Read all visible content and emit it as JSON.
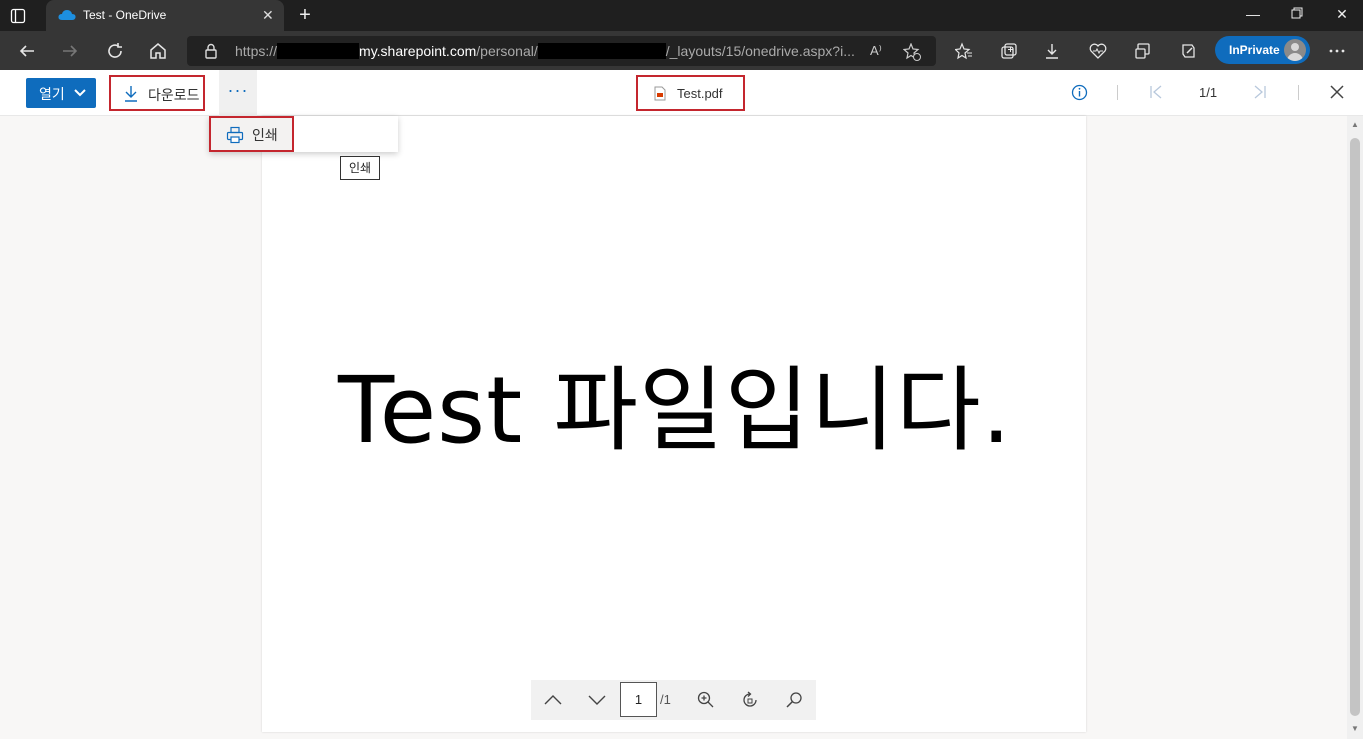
{
  "browser": {
    "tab_title": "Test - OneDrive",
    "url_prefix": "https://",
    "url_host": "my.sharepoint.com",
    "url_mid": "/personal/",
    "url_suffix": "/_layouts/15/onedrive.aspx?i...",
    "inprivate_label": "InPrivate"
  },
  "cmdbar": {
    "open_label": "열기",
    "download_label": "다운로드",
    "more_label": "···",
    "file_name": "Test.pdf",
    "page_count": "1/1"
  },
  "menu": {
    "print_label": "인쇄",
    "tooltip": "인쇄"
  },
  "document": {
    "text": "Test 파일입니다."
  },
  "pdf_toolbar": {
    "page_input": "1",
    "page_total": "/1"
  },
  "colors": {
    "accent": "#0f6cbd",
    "highlight_box": "#c4262e"
  }
}
